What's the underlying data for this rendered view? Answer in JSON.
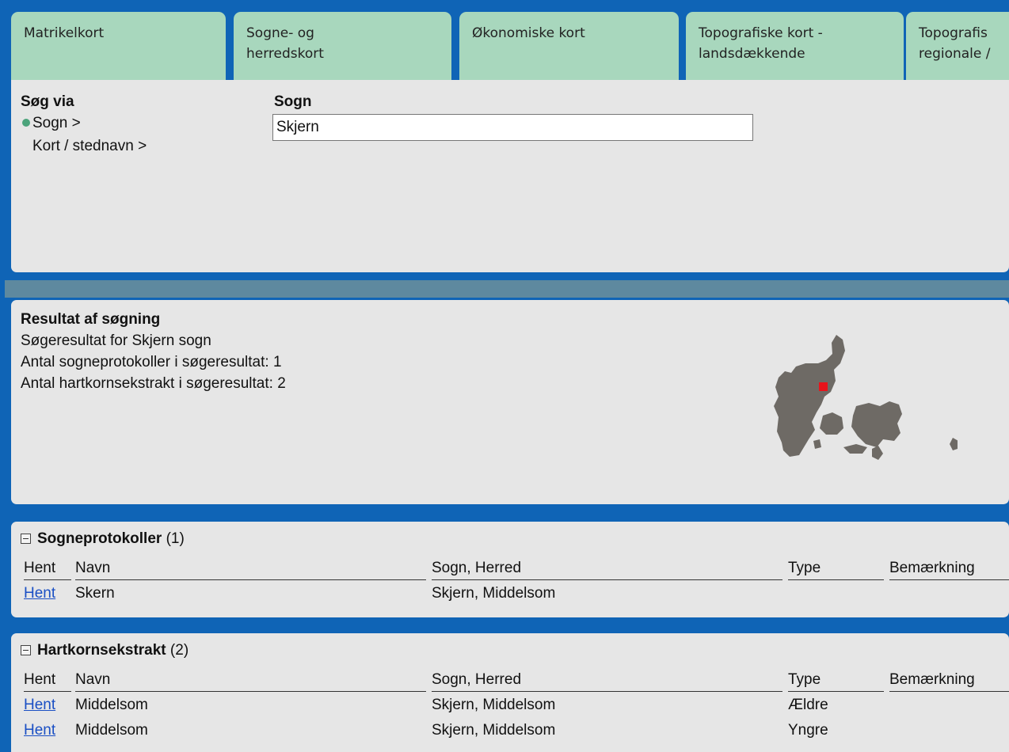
{
  "tabs": [
    {
      "line1": "Matrikelkort",
      "line2": ""
    },
    {
      "line1": "Sogne- og",
      "line2": "herredskort"
    },
    {
      "line1": "Økonomiske kort",
      "line2": ""
    },
    {
      "line1": "Topografiske kort -",
      "line2": "landsdækkende"
    },
    {
      "line1": "Topografis",
      "line2": "regionale /"
    }
  ],
  "search": {
    "heading": "Søg via",
    "options": [
      {
        "label": "Sogn >",
        "selected": true
      },
      {
        "label": "Kort / stednavn >",
        "selected": false
      }
    ],
    "field_label": "Sogn",
    "field_value": "Skjern"
  },
  "result": {
    "title": "Resultat af søgning",
    "line1": "Søgeresultat for Skjern sogn",
    "line2": "Antal sogneprotokoller i søgeresultat: 1",
    "line3": "Antal hartkornsekstrakt i søgeresultat: 2",
    "map_icon": "denmark-map-icon",
    "marker_color": "#e8141b",
    "map_color": "#6e6a65"
  },
  "columns": [
    "Hent",
    "Navn",
    "Sogn, Herred",
    "Type",
    "Bemærkning"
  ],
  "sogneprotokoller": {
    "title": "Sogneprotokoller",
    "count": "(1)",
    "rows": [
      {
        "hent": "Hent",
        "navn": "Skern",
        "sogn": "Skjern, Middelsom",
        "type": "",
        "bem": ""
      }
    ]
  },
  "hartkorn": {
    "title": "Hartkornsekstrakt",
    "count": "(2)",
    "rows": [
      {
        "hent": "Hent",
        "navn": "Middelsom",
        "sogn": "Skjern, Middelsom",
        "type": "Ældre",
        "bem": ""
      },
      {
        "hent": "Hent",
        "navn": "Middelsom",
        "sogn": "Skjern, Middelsom",
        "type": "Yngre",
        "bem": ""
      }
    ]
  },
  "colors": {
    "background": "#0f64b6",
    "tab": "#a8d7bd",
    "panel": "#e6e6e6",
    "stripe": "#5e899f",
    "link": "#1a4fc4",
    "radio": "#4ba37b"
  }
}
